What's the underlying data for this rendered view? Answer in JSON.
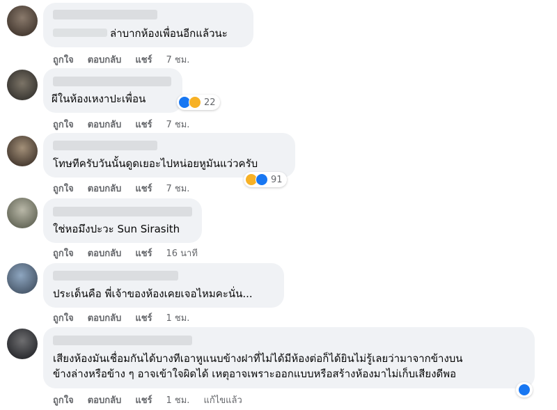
{
  "comments": [
    {
      "text": "ล่าบากห้องเพื่อนอีกแล้วนะ",
      "actions": {
        "like": "ถูกใจ",
        "reply": "ตอบกลับ",
        "share": "แชร์",
        "time": "7 ชม."
      }
    },
    {
      "text": "ผีในห้องเหงาปะเพื่อน",
      "reactions": {
        "icons": [
          "like-icon",
          "haha-icon"
        ],
        "count": "22"
      },
      "actions": {
        "like": "ถูกใจ",
        "reply": "ตอบกลับ",
        "share": "แชร์",
        "time": "7 ชม."
      }
    },
    {
      "text": "โทษทีครับวันนั้นดูดเยอะไปหน่อยหูมันแว่วครับ",
      "reactions": {
        "icons": [
          "haha-icon",
          "like-icon"
        ],
        "count": "91"
      },
      "actions": {
        "like": "ถูกใจ",
        "reply": "ตอบกลับ",
        "share": "แชร์",
        "time": "7 ชม."
      }
    },
    {
      "text": "ใช่หอมึงปะวะ Sun Sirasith",
      "actions": {
        "like": "ถูกใจ",
        "reply": "ตอบกลับ",
        "share": "แชร์",
        "time": "16 นาที"
      }
    },
    {
      "text": "ประเด็นคือ พี่เจ้าของห้องเคยเจอไหมคะนั่น...",
      "actions": {
        "like": "ถูกใจ",
        "reply": "ตอบกลับ",
        "share": "แชร์",
        "time": "1 ชม."
      }
    },
    {
      "text_line1": "เสียงห้องมันเชื่อมกันได้บางทีเอาหูแนบข้างฝาที่ไม่ได้มีห้องต่อก็ได้ยินไม่รู้เลยว่ามาจากข้างบน",
      "text_line2": "ข้างล่างหรือข้าง ๆ อาจเข้าใจผิดได้ เหตุอาจเพราะออกแบบหรือสร้างห้องมาไม่เก็บเสียงดีพอ",
      "reactions": {
        "icons": [
          "like-icon"
        ],
        "count": ""
      },
      "actions": {
        "like": "ถูกใจ",
        "reply": "ตอบกลับ",
        "share": "แชร์",
        "time": "1 ชม.",
        "edited": "แก้ไขแล้ว"
      }
    }
  ],
  "colors": {
    "bubble": "#f0f2f5",
    "meta": "#65676b",
    "like": "#1877f2",
    "haha": "#f7b125"
  }
}
